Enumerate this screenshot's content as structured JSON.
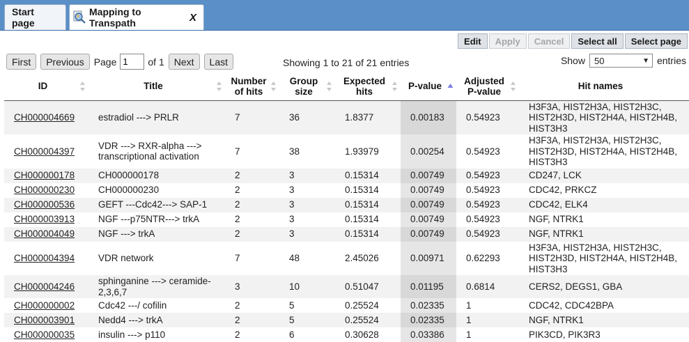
{
  "tabs": [
    {
      "label": "Start page"
    },
    {
      "label": "Mapping to Transpath",
      "close": "X"
    }
  ],
  "toolbar": {
    "edit": "Edit",
    "apply": "Apply",
    "cancel": "Cancel",
    "select_all": "Select all",
    "select_page": "Select page"
  },
  "pager": {
    "first": "First",
    "previous": "Previous",
    "page_label": "Page",
    "page_value": "1",
    "of_label": "of 1",
    "next": "Next",
    "last": "Last"
  },
  "info": "Showing 1 to 21 of 21 entries",
  "show": {
    "label": "Show",
    "value": "50",
    "suffix": "entries"
  },
  "table": {
    "headers": {
      "id": "ID",
      "title": "Title",
      "hits": "Number of hits",
      "group": "Group size",
      "expected": "Expected hits",
      "pvalue": "P-value",
      "adjusted": "Adjusted P-value",
      "names": "Hit names"
    },
    "rows": [
      {
        "id": "CH000004669",
        "title": "estradiol ---> PRLR",
        "hits": "7",
        "group": "36",
        "expected": "1.8377",
        "pvalue": "0.00183",
        "adjusted": "0.54923",
        "names": "H3F3A, HIST2H3A, HIST2H3C, HIST2H3D, HIST2H4A, HIST2H4B, HIST3H3"
      },
      {
        "id": "CH000004397",
        "title": "VDR ---> RXR-alpha ---> transcriptional activation",
        "hits": "7",
        "group": "38",
        "expected": "1.93979",
        "pvalue": "0.00254",
        "adjusted": "0.54923",
        "names": "H3F3A, HIST2H3A, HIST2H3C, HIST2H3D, HIST2H4A, HIST2H4B, HIST3H3"
      },
      {
        "id": "CH000000178",
        "title": "CH000000178",
        "hits": "2",
        "group": "3",
        "expected": "0.15314",
        "pvalue": "0.00749",
        "adjusted": "0.54923",
        "names": "CD247, LCK"
      },
      {
        "id": "CH000000230",
        "title": "CH000000230",
        "hits": "2",
        "group": "3",
        "expected": "0.15314",
        "pvalue": "0.00749",
        "adjusted": "0.54923",
        "names": "CDC42, PRKCZ"
      },
      {
        "id": "CH000000536",
        "title": "GEFT ---Cdc42---> SAP-1",
        "hits": "2",
        "group": "3",
        "expected": "0.15314",
        "pvalue": "0.00749",
        "adjusted": "0.54923",
        "names": "CDC42, ELK4"
      },
      {
        "id": "CH000003913",
        "title": "NGF ---p75NTR---> trkA",
        "hits": "2",
        "group": "3",
        "expected": "0.15314",
        "pvalue": "0.00749",
        "adjusted": "0.54923",
        "names": "NGF, NTRK1"
      },
      {
        "id": "CH000004049",
        "title": "NGF ---> trkA",
        "hits": "2",
        "group": "3",
        "expected": "0.15314",
        "pvalue": "0.00749",
        "adjusted": "0.54923",
        "names": "NGF, NTRK1"
      },
      {
        "id": "CH000004394",
        "title": "VDR network",
        "hits": "7",
        "group": "48",
        "expected": "2.45026",
        "pvalue": "0.00971",
        "adjusted": "0.62293",
        "names": "H3F3A, HIST2H3A, HIST2H3C, HIST2H3D, HIST2H4A, HIST2H4B, HIST3H3"
      },
      {
        "id": "CH000004246",
        "title": "sphinganine ---> ceramide-2,3,6,7",
        "hits": "3",
        "group": "10",
        "expected": "0.51047",
        "pvalue": "0.01195",
        "adjusted": "0.6814",
        "names": "CERS2, DEGS1, GBA"
      },
      {
        "id": "CH000000002",
        "title": "Cdc42 ---/ cofilin",
        "hits": "2",
        "group": "5",
        "expected": "0.25524",
        "pvalue": "0.02335",
        "adjusted": "1",
        "names": "CDC42, CDC42BPA"
      },
      {
        "id": "CH000003901",
        "title": "Nedd4 ---> trkA",
        "hits": "2",
        "group": "5",
        "expected": "0.25524",
        "pvalue": "0.02335",
        "adjusted": "1",
        "names": "NGF, NTRK1"
      },
      {
        "id": "CH000000035",
        "title": "insulin ---> p110",
        "hits": "2",
        "group": "6",
        "expected": "0.30628",
        "pvalue": "0.03386",
        "adjusted": "1",
        "names": "PIK3CD, PIK3R3"
      }
    ]
  }
}
